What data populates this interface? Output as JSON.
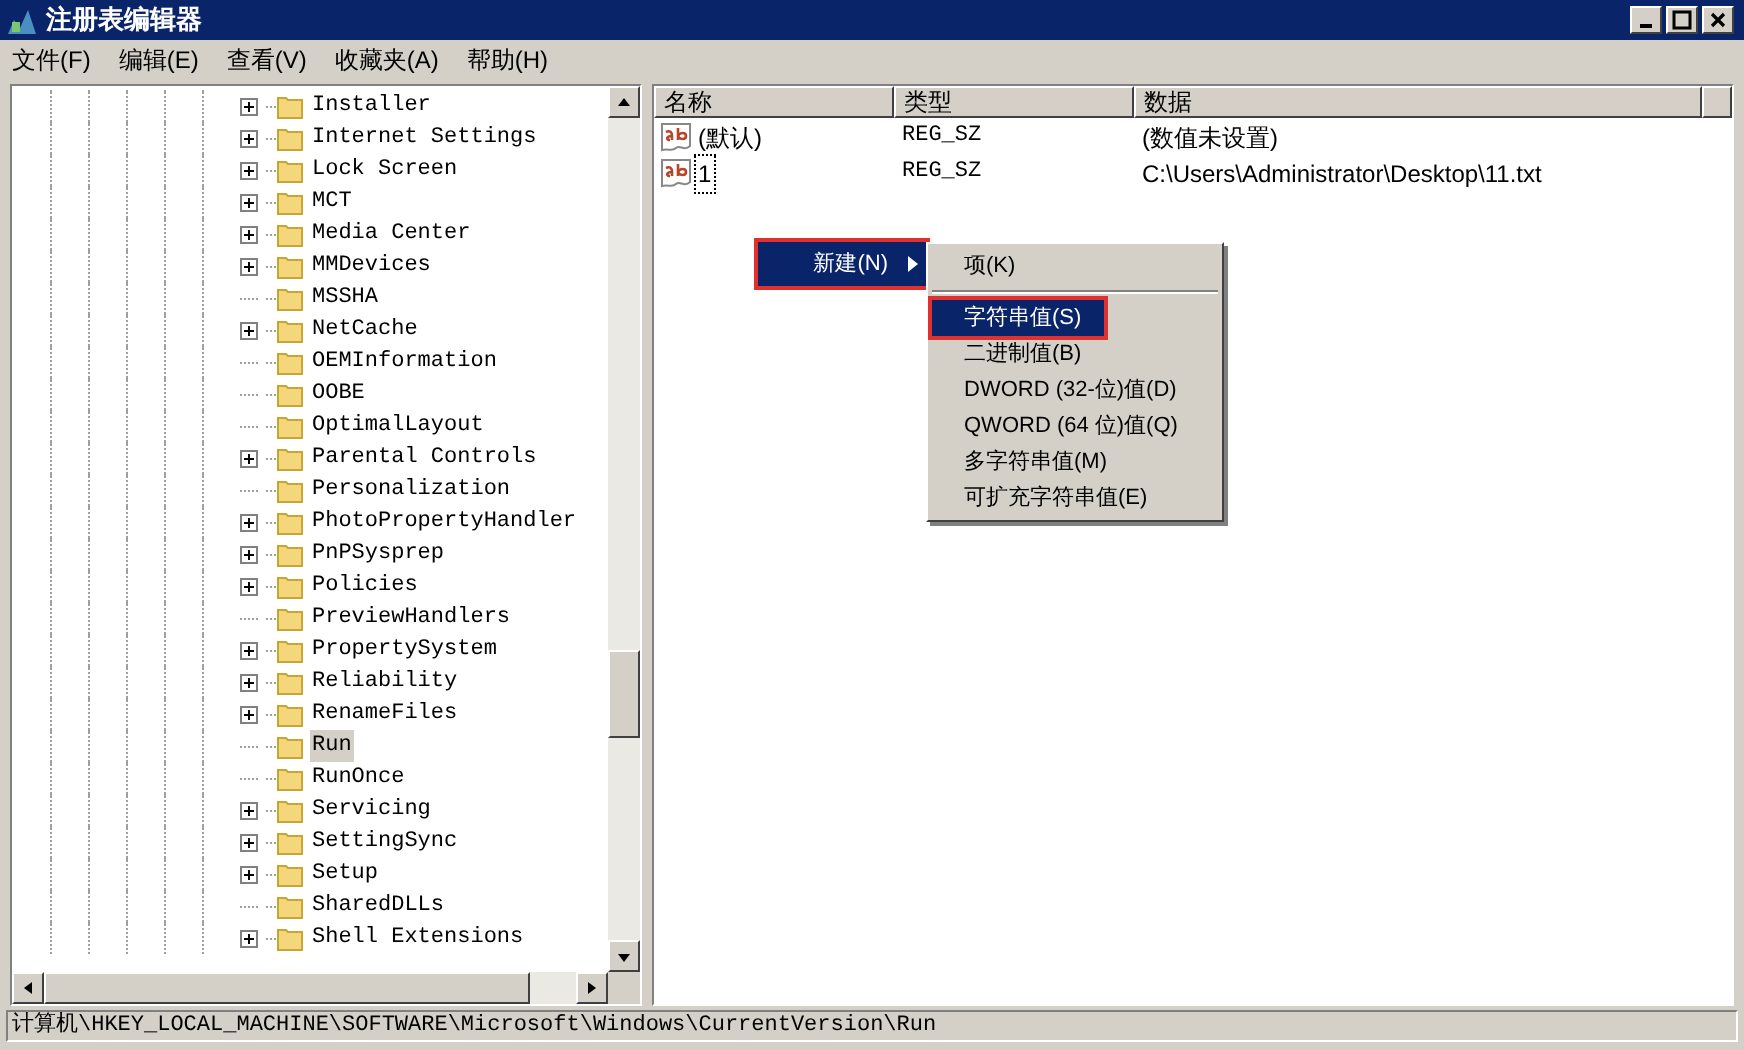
{
  "window": {
    "title": "注册表编辑器"
  },
  "menu_bar": [
    "文件(F)",
    "编辑(E)",
    "查看(V)",
    "收藏夹(A)",
    "帮助(H)"
  ],
  "tree": [
    {
      "label": "Installer",
      "expandable": true,
      "selected": false
    },
    {
      "label": "Internet Settings",
      "expandable": true,
      "selected": false
    },
    {
      "label": "Lock Screen",
      "expandable": true,
      "selected": false
    },
    {
      "label": "MCT",
      "expandable": true,
      "selected": false
    },
    {
      "label": "Media Center",
      "expandable": true,
      "selected": false
    },
    {
      "label": "MMDevices",
      "expandable": true,
      "selected": false
    },
    {
      "label": "MSSHA",
      "expandable": false,
      "selected": false
    },
    {
      "label": "NetCache",
      "expandable": true,
      "selected": false
    },
    {
      "label": "OEMInformation",
      "expandable": false,
      "selected": false
    },
    {
      "label": "OOBE",
      "expandable": false,
      "selected": false
    },
    {
      "label": "OptimalLayout",
      "expandable": false,
      "selected": false
    },
    {
      "label": "Parental Controls",
      "expandable": true,
      "selected": false
    },
    {
      "label": "Personalization",
      "expandable": false,
      "selected": false
    },
    {
      "label": "PhotoPropertyHandler",
      "expandable": true,
      "selected": false
    },
    {
      "label": "PnPSysprep",
      "expandable": true,
      "selected": false
    },
    {
      "label": "Policies",
      "expandable": true,
      "selected": false
    },
    {
      "label": "PreviewHandlers",
      "expandable": false,
      "selected": false
    },
    {
      "label": "PropertySystem",
      "expandable": true,
      "selected": false
    },
    {
      "label": "Reliability",
      "expandable": true,
      "selected": false
    },
    {
      "label": "RenameFiles",
      "expandable": true,
      "selected": false
    },
    {
      "label": "Run",
      "expandable": false,
      "selected": true
    },
    {
      "label": "RunOnce",
      "expandable": false,
      "selected": false
    },
    {
      "label": "Servicing",
      "expandable": true,
      "selected": false
    },
    {
      "label": "SettingSync",
      "expandable": true,
      "selected": false
    },
    {
      "label": "Setup",
      "expandable": true,
      "selected": false
    },
    {
      "label": "SharedDLLs",
      "expandable": false,
      "selected": false
    },
    {
      "label": "Shell Extensions",
      "expandable": true,
      "selected": false
    }
  ],
  "table": {
    "columns": [
      "名称",
      "类型",
      "数据"
    ],
    "rows": [
      {
        "name": "(默认)",
        "type": "REG_SZ",
        "data": "(数值未设置)",
        "focused": false
      },
      {
        "name": "1",
        "type": "REG_SZ",
        "data": "C:\\Users\\Administrator\\Desktop\\11.txt",
        "focused": true
      }
    ]
  },
  "context_menu": {
    "label": "新建(N)",
    "selected": true,
    "outlined": true,
    "submenu": [
      {
        "kind": "item",
        "label": "项(K)",
        "selected": false,
        "outlined": false
      },
      {
        "kind": "separator"
      },
      {
        "kind": "item",
        "label": "字符串值(S)",
        "selected": true,
        "outlined": true
      },
      {
        "kind": "item",
        "label": "二进制值(B)",
        "selected": false,
        "outlined": false
      },
      {
        "kind": "item",
        "label": "DWORD (32-位)值(D)",
        "selected": false,
        "outlined": false
      },
      {
        "kind": "item",
        "label": "QWORD (64 位)值(Q)",
        "selected": false,
        "outlined": false
      },
      {
        "kind": "item",
        "label": "多字符串值(M)",
        "selected": false,
        "outlined": false
      },
      {
        "kind": "item",
        "label": "可扩充字符串值(E)",
        "selected": false,
        "outlined": false
      }
    ]
  },
  "status_bar": "计算机\\HKEY_LOCAL_MACHINE\\SOFTWARE\\Microsoft\\Windows\\CurrentVersion\\Run"
}
